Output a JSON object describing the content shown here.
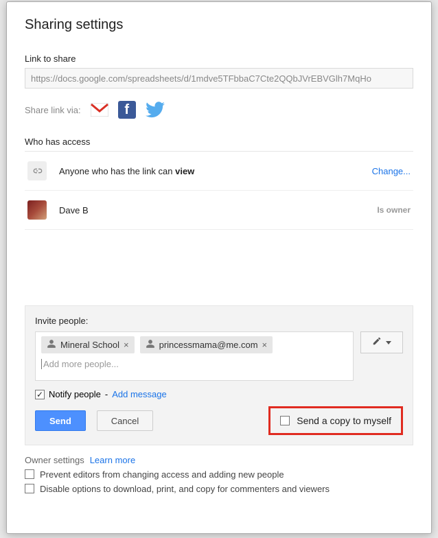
{
  "title": "Sharing settings",
  "link": {
    "label": "Link to share",
    "value": "https://docs.google.com/spreadsheets/d/1mdve5TFbbaC7Cte2QQbJVrEBVGlh7MqHo"
  },
  "shareVia": {
    "label": "Share link via:"
  },
  "access": {
    "heading": "Who has access",
    "anyonePrefix": "Anyone who has the link can ",
    "anyoneMode": "view",
    "changeLabel": "Change...",
    "owner": {
      "name": "Dave B",
      "tag": "Is owner"
    }
  },
  "invite": {
    "label": "Invite people:",
    "chips": [
      {
        "label": "Mineral School"
      },
      {
        "label": "princessmama@me.com"
      }
    ],
    "addMorePlaceholder": "Add more people..."
  },
  "notify": {
    "checked": true,
    "label": "Notify people",
    "sep": " - ",
    "addMessage": "Add message"
  },
  "buttons": {
    "send": "Send",
    "cancel": "Cancel"
  },
  "sendCopy": {
    "checked": false,
    "label": "Send a copy to myself"
  },
  "ownerSettings": {
    "title": "Owner settings",
    "learnMore": "Learn more",
    "opt1": {
      "checked": false,
      "label": "Prevent editors from changing access and adding new people"
    },
    "opt2": {
      "checked": false,
      "label": "Disable options to download, print, and copy for commenters and viewers"
    }
  }
}
